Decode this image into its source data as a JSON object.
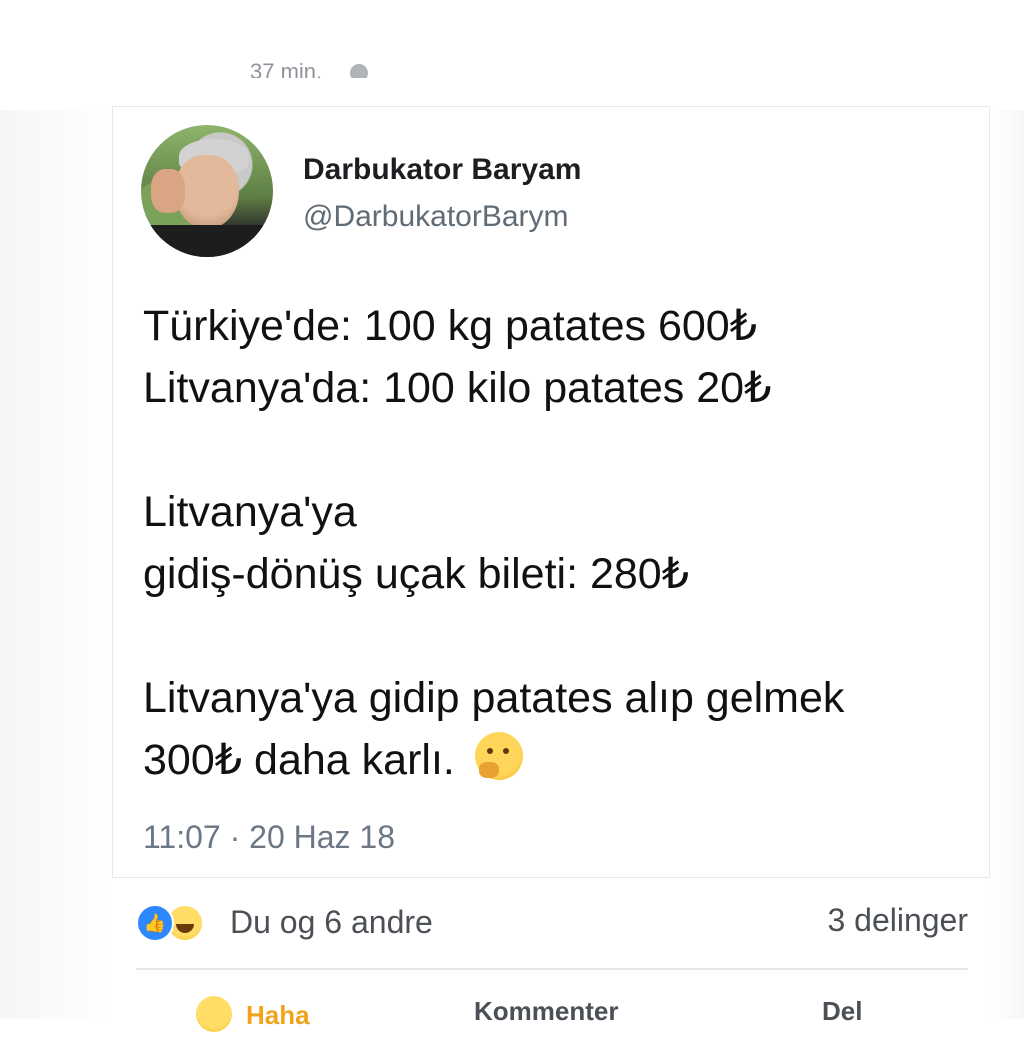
{
  "top_partial": {
    "time": "37 min."
  },
  "tweet": {
    "author_name": "Darbukator Baryam",
    "author_handle": "@DarbukatorBarym",
    "lines": [
      "Türkiye'de: 100 kg patates 600₺",
      "Litvanya'da: 100 kilo patates 20₺",
      "Litvanya'ya",
      "gidiş-dönüş uçak bileti: 280₺",
      "Litvanya'ya gidip patates alıp gelmek",
      "300₺ daha karlı."
    ],
    "timestamp": "11:07 · 20 Haz 18"
  },
  "reactions": {
    "summary": "Du og 6 andre",
    "shares": "3 delinger"
  },
  "actions": {
    "haha_label": "Haha",
    "comment_label": "Kommenter",
    "share_label": "Del"
  },
  "icons": {
    "like": "like-icon",
    "haha": "haha-icon",
    "thinking": "thinking-face-icon",
    "globe": "globe-icon"
  },
  "colors": {
    "like_blue": "#2d88ff",
    "haha_yellow": "#f5b81c",
    "muted_text": "#6b7785"
  }
}
